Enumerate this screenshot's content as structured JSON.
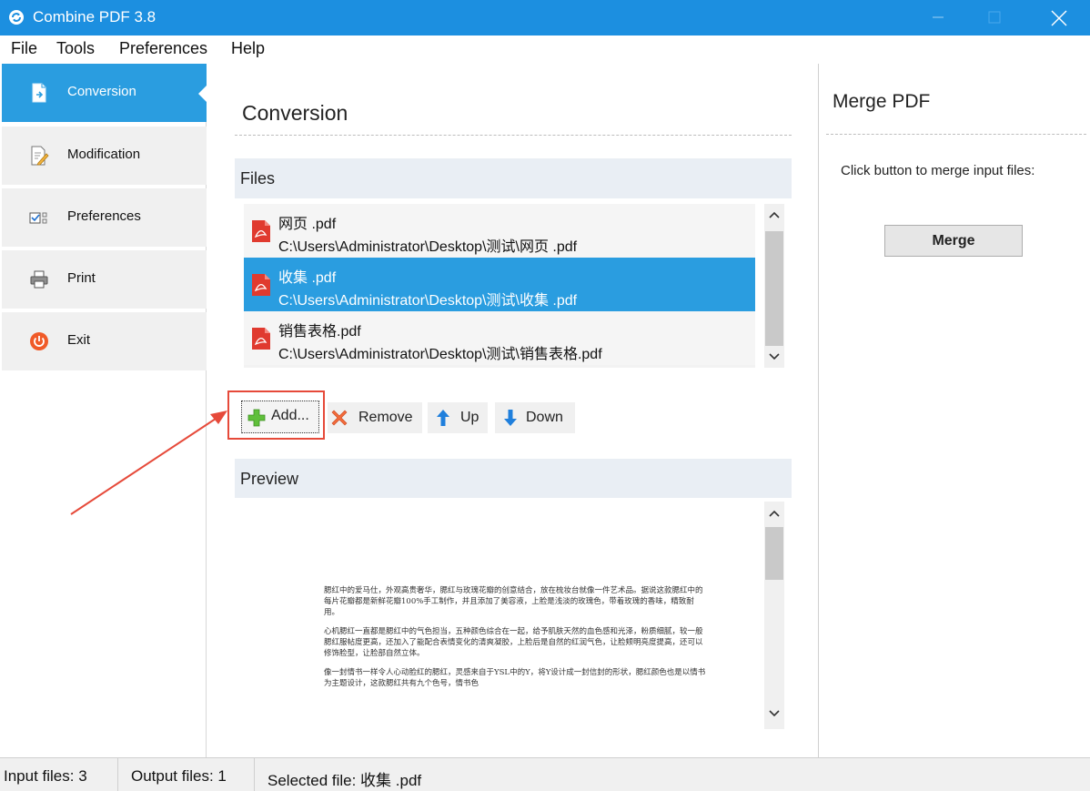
{
  "window": {
    "title": "Combine PDF 3.8",
    "colors": {
      "titlebar": "#1c8fe0",
      "accent": "#2a9de0",
      "highlight": "#e64a3a"
    }
  },
  "menu": [
    "File",
    "Tools",
    "Preferences",
    "Help"
  ],
  "sidebar": {
    "items": [
      {
        "label": "Conversion",
        "icon": "conversion-icon",
        "active": true
      },
      {
        "label": "Modification",
        "icon": "edit-icon",
        "active": false
      },
      {
        "label": "Preferences",
        "icon": "checkbox-icon",
        "active": false
      },
      {
        "label": "Print",
        "icon": "printer-icon",
        "active": false
      },
      {
        "label": "Exit",
        "icon": "power-icon",
        "active": false
      }
    ]
  },
  "main": {
    "title": "Conversion",
    "files_header": "Files",
    "files": [
      {
        "name": "网页 .pdf",
        "path": "C:\\Users\\Administrator\\Desktop\\测试\\网页 .pdf",
        "selected": false
      },
      {
        "name": "收集 .pdf",
        "path": "C:\\Users\\Administrator\\Desktop\\测试\\收集 .pdf",
        "selected": true
      },
      {
        "name": "销售表格.pdf",
        "path": "C:\\Users\\Administrator\\Desktop\\测试\\销售表格.pdf",
        "selected": false
      }
    ],
    "buttons": {
      "add": "Add...",
      "remove": "Remove",
      "up": "Up",
      "down": "Down"
    },
    "preview_header": "Preview",
    "preview_paragraphs": [
      "腮红中的爱马仕，外观高贵奢华，腮红与玫瑰花瓣的创意结合，放在梳妆台就像一件艺术品。据说这款腮红中的每片花瓣都是新鲜花瓣100%手工制作，并且添加了美容液，上脸是浅淡的玫瑰色，带着玫瑰的香味，精致耐用。",
      "心机腮红一直都是腮红中的气色担当，五种颜色综合在一起，给予肌肤天然的血色感和光泽，粉质细腻，较一般腮红服帖度更高，还加入了能配合表情变化的清爽凝胶，上脸后是自然的红润气色，让脸颊明亮度提高，还可以修饰脸型，让脸部自然立体。",
      "像一封情书一样令人心动脸红的腮红，灵感来自于YSL中的Y，将Y设计成一封信封的形状，腮红颜色也是以情书为主题设计，这款腮红共有九个色号，情书色"
    ]
  },
  "merge": {
    "title": "Merge PDF",
    "instruction": "Click button to merge input files:",
    "button": "Merge"
  },
  "status": {
    "input": "Input files: 3",
    "output": "Output files: 1",
    "selected": "Selected file: 收集 .pdf"
  }
}
